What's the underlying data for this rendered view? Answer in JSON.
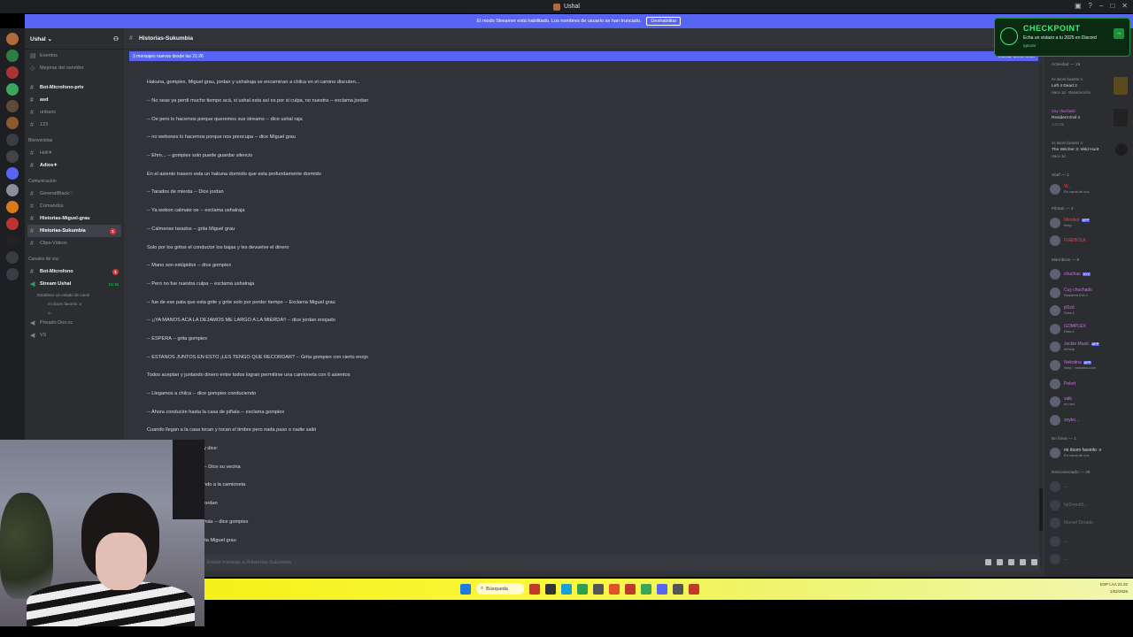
{
  "window": {
    "title": "Ushal"
  },
  "banner": {
    "text": "El modo Streamer está habilitado. Los nombres de usuario se han truncado.",
    "button": "Deshabilitar"
  },
  "checkpoint": {
    "title": "CHECKPOINT",
    "subtitle": "Echa un vistazo a tu 2025 en Discord",
    "dismiss": "Ignorar",
    "go": "→"
  },
  "guild": {
    "name": "Ushal ⌄"
  },
  "sidebar": {
    "top": [
      {
        "label": "Eventos"
      },
      {
        "label": "Mejoras del servidor"
      }
    ],
    "channels_a": [
      {
        "label": "Bot-Microfono-priv",
        "bold": true
      },
      {
        "label": "asd",
        "bold": true
      },
      {
        "label": "unbans",
        "bold": false
      },
      {
        "label": "123",
        "bold": false
      }
    ],
    "cat1": "Bienvenidas",
    "channels_b": [
      {
        "label": "Holi✦",
        "bold": false
      },
      {
        "label": "Adios✦",
        "bold": true
      }
    ],
    "cat2": "Comunicacion",
    "channels_c": [
      {
        "label": "GeneralBlack♡",
        "bold": false
      },
      {
        "label": "Comandos",
        "bold": false
      },
      {
        "label": "Historias-Miguel-grau",
        "bold": true
      },
      {
        "label": "Historias-Sukumbia",
        "bold": true,
        "badge": "1"
      },
      {
        "label": "Clips-Videos",
        "bold": false
      }
    ],
    "cat3": "Canales de voz",
    "voice": [
      {
        "label": "Bot-Microfono",
        "bold": true,
        "badge": "1"
      },
      {
        "label": "Stream Ushal",
        "bold": true,
        "time": "21:15"
      }
    ],
    "voice_sub": [
      "Establece un estado de canal",
      "mi doom favorito :v",
      "u..."
    ],
    "voice2": [
      {
        "label": "Privado Dos-cc"
      },
      {
        "label": "VS"
      }
    ]
  },
  "chat": {
    "channel": "Historias-Sukumbia",
    "newbar": "3 mensajes nuevos desde las 21:26",
    "newbar_action": "Marcar como leído",
    "composer_placeholder": "Enviar mensaje a #Historias-Sukumbia",
    "messages": [
      "Hakuna, gompiex, Miguel grau, jordan y ushalraja se encaminan a chilca en el camino discuten...",
      "-- No seas ya perdí mucho tiempo acá, si ushal esta así es por si culpa, no nuestra -- exclama jordan",
      "-- Oe pero lo hacemos porque queremos sus streams -- dice ushal raja",
      "-- no webones lo hacemos porque nos preocupa -- dice Miguel grau",
      "-- Ehm... -- gompiex solo puede guardar silencio",
      "En el asiento trasero esta un hakuna dormido que esta profundamente dormido",
      "-- Tarados de mierda -- Dice jordan",
      "-- Ya webon calmate oe -- exclama ushalraja",
      "-- Calmense tarados -- grita Miguel grau",
      "Solo por los gritos el conductor los bajas y les devuelve el dinero",
      "-- Mano son estúpidos -- dice gompiex",
      "-- Pero no fue nuestra culpa -- exclama ushalraja",
      "-- fue de ese pata que esta grite y grite solo por perder tiempo -- Exclama Miguel grau",
      "-- ¡¡YA MANOS ACA LA DEJAMOS ME LARGO A LA MIERDA!! -- dice jordan enojado",
      "-- ESPERA -- grita gompiex",
      "-- ESTANOS JUNTOS EN ESTO ¡LES TENGO QUE RECORDAR? -- Grita gompiex con cierto enojo",
      "Todos aceptan y juntando dinero entre todos logran permitirse una camioneta con 6 asientos",
      "-- Llegamos a chilca -- dice gompiex conduciendo",
      "-- Ahora conducire hasta la casa de piñata -- exclama gompiex",
      "Cuando llegan a la casa tocan y tocan el timbre pero nada paso o nadie salió",
      "y dice:",
      "-- Dice su vecina",
      "ndo a la camioneta",
      "jordan",
      "más -- dice gompiex",
      "ita Miguel grau",
      "ue esta por cuzco, tenemos que ir y de hay porfin ayudar a ushal -- exclama hakuna"
    ]
  },
  "members": {
    "activity_head": "Actividad — 19",
    "activities": [
      {
        "user": "mi doom favorito :v",
        "game": "Left 4 Dead 2",
        "meta": "Hace 1d · Resurrección"
      },
      {
        "user": "Cuy chuchado",
        "game": "Resident Evil 4",
        "meta": "1:51:55"
      },
      {
        "user": "mi doom favorito :v",
        "game": "The Witcher 3: Wild Hunt",
        "meta": "Hace 1d"
      }
    ],
    "staff_head": "Staff — 1",
    "staff": [
      {
        "name": "W...",
        "status": "En canal de voz",
        "color": "#f23f43"
      }
    ],
    "pilotas_head": "Pilotas — 2",
    "pilotas": [
      {
        "name": "Mimibot",
        "status": "/help",
        "color": "#f23f43",
        "tag": "APP"
      },
      {
        "name": "FIREBOLA",
        "status": "",
        "color": "#f23f43"
      }
    ],
    "miembros_head": "Miembros — 9",
    "miembros": [
      {
        "name": "chuchas",
        "status": "",
        "color": "#c678dd",
        "tag": "XYZ"
      },
      {
        "name": "Cuy chuchado",
        "status": "Resident Evil 4",
        "color": "#c678dd"
      },
      {
        "name": "jd1c6",
        "status": "Dota 2",
        "color": "#c678dd"
      },
      {
        "name": "GOMPLEX",
        "status": "Dota 2",
        "color": "#c678dd"
      },
      {
        "name": "Jockie Music",
        "status": "m!help",
        "color": "#c678dd",
        "tag": "APP"
      },
      {
        "name": "Nekotina",
        "status": "!help · nekotina.com",
        "color": "#c678dd",
        "tag": "APP"
      },
      {
        "name": "Pelert",
        "status": "",
        "color": "#c678dd"
      },
      {
        "name": "valk",
        "status": "no hex",
        "color": "#c678dd"
      },
      {
        "name": "zeyko...",
        "status": "",
        "color": "#c678dd"
      }
    ],
    "online_head": "En línea — 1",
    "online": [
      {
        "name": "mi doom favorito :v",
        "status": "En canal de voz",
        "color": "#dbdee1"
      }
    ],
    "offline_head": "Desconectado — 49",
    "offline": [
      {
        "name": "..."
      },
      {
        "name": "hjr2mmb5..."
      },
      {
        "name": "Marvel Dorado"
      },
      {
        "name": "..."
      },
      {
        "name": "..."
      }
    ]
  },
  "taskbar": {
    "search": "Búsqueda",
    "lang": "ESP LAA",
    "time": "21:32",
    "date": "1/02/2026"
  },
  "colors": {
    "accent": "#5865f2",
    "chat_bg": "#313338",
    "sidebar_bg": "#2b2d31",
    "taskbar": "#f4f11a",
    "checkpoint": "#3ef07a"
  }
}
